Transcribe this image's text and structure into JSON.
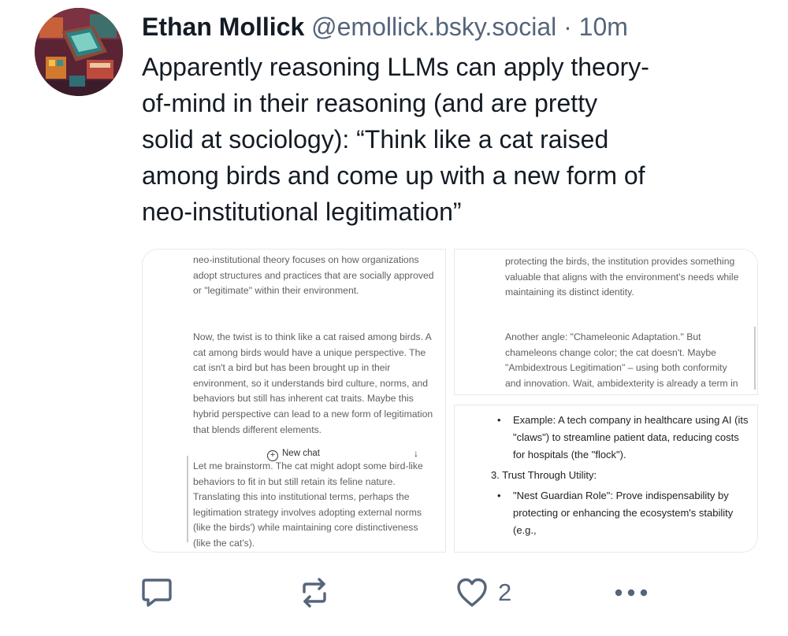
{
  "post": {
    "author_name": "Ethan Mollick",
    "handle": "@emollick.bsky.social",
    "separator": "·",
    "time": "10m",
    "text_lines": [
      "Apparently reasoning LLMs can apply theory-",
      "of-mind in their reasoning (and are pretty",
      "solid at sociology): “Think like a cat raised",
      "among birds and come up with a new form of",
      "neo-institutional legitimation”"
    ]
  },
  "images": {
    "left": {
      "para1": "neo-institutional theory focuses on how organizations adopt structures and practices that are socially approved or \"legitimate\" within their environment.",
      "para2": "Now, the twist is to think like a cat raised among birds. A cat among birds would have a unique perspective. The cat isn't a bird but has been brought up in their environment, so it understands bird culture, norms, and behaviors but still has inherent cat traits. Maybe this hybrid perspective can lead to a new form of legitimation that blends different elements.",
      "new_chat_label": "New chat",
      "para3": "Let me brainstorm. The cat might adopt some bird-like behaviors to fit in but still retain its feline nature. Translating this into institutional terms, perhaps the legitimation strategy involves adopting external norms (like the birds') while maintaining core distinctiveness (like the cat's)."
    },
    "top_right": {
      "para1": "protecting the birds, the institution provides something valuable that aligns with the environment's needs while maintaining its distinct identity.",
      "para2": "Another angle: \"Chameleonic Adaptation.\" But chameleons change color; the cat doesn't. Maybe \"Ambidextrous Legitimation\" – using both conformity and innovation. Wait, ambidexterity is already a term in management for balancing"
    },
    "bottom_right": {
      "example_bullet": "Example: A tech company in healthcare using AI (its \"claws\") to streamline patient data, reducing costs for hospitals (the \"flock\").",
      "section_title": "3. Trust Through Utility:",
      "guardian_bullet": "\"Nest Guardian Role\": Prove indispensability by protecting or enhancing the ecosystem's stability (e.g.,"
    }
  },
  "actions": {
    "like_count": "2"
  },
  "icons": {
    "reply": "reply-icon",
    "repost": "repost-icon",
    "like": "heart-icon",
    "more": "more-icon"
  },
  "colors": {
    "text": "#141b24",
    "muted": "#55657a",
    "icon": "#55657a"
  }
}
